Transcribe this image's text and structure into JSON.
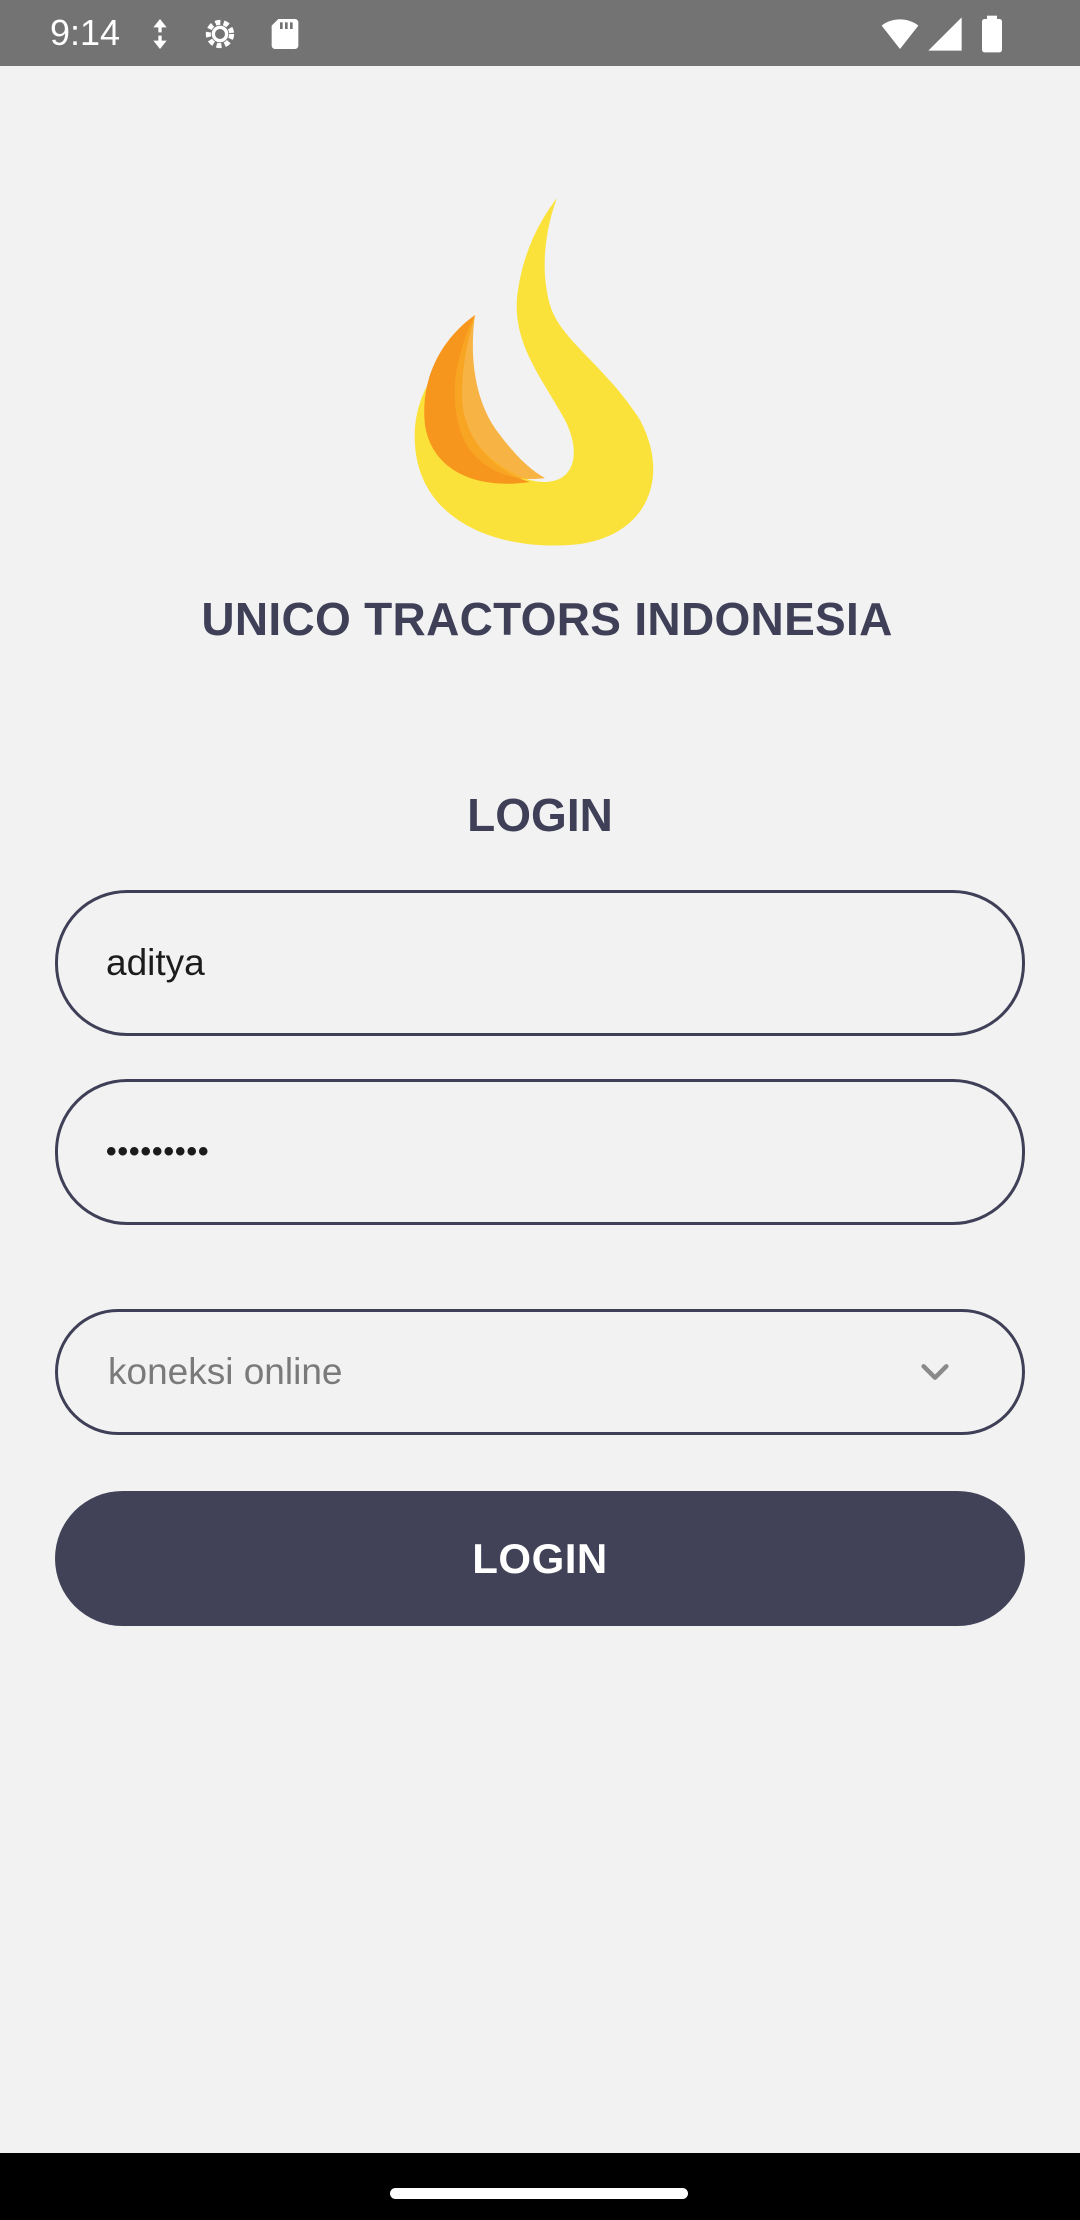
{
  "status_bar": {
    "time": "9:14",
    "left_icons": [
      "data-saver-icon",
      "settings-gear-icon",
      "sd-card-icon"
    ],
    "right_icons": [
      "wifi-icon",
      "cell-signal-icon",
      "battery-icon"
    ]
  },
  "logo": {
    "icon": "flame-logo-icon",
    "colors": {
      "outer": "#fbe23a",
      "inner": "#f7961d"
    }
  },
  "company_name": "UNICO TRACTORS INDONESIA",
  "login_title": "LOGIN",
  "form": {
    "username_value": "aditya",
    "password_value": "•••••••••",
    "connection_select_value": "koneksi online",
    "submit_label": "LOGIN"
  },
  "theme": {
    "primary": "#414257",
    "background": "#f2f2f3",
    "status_bar": "#737373"
  }
}
